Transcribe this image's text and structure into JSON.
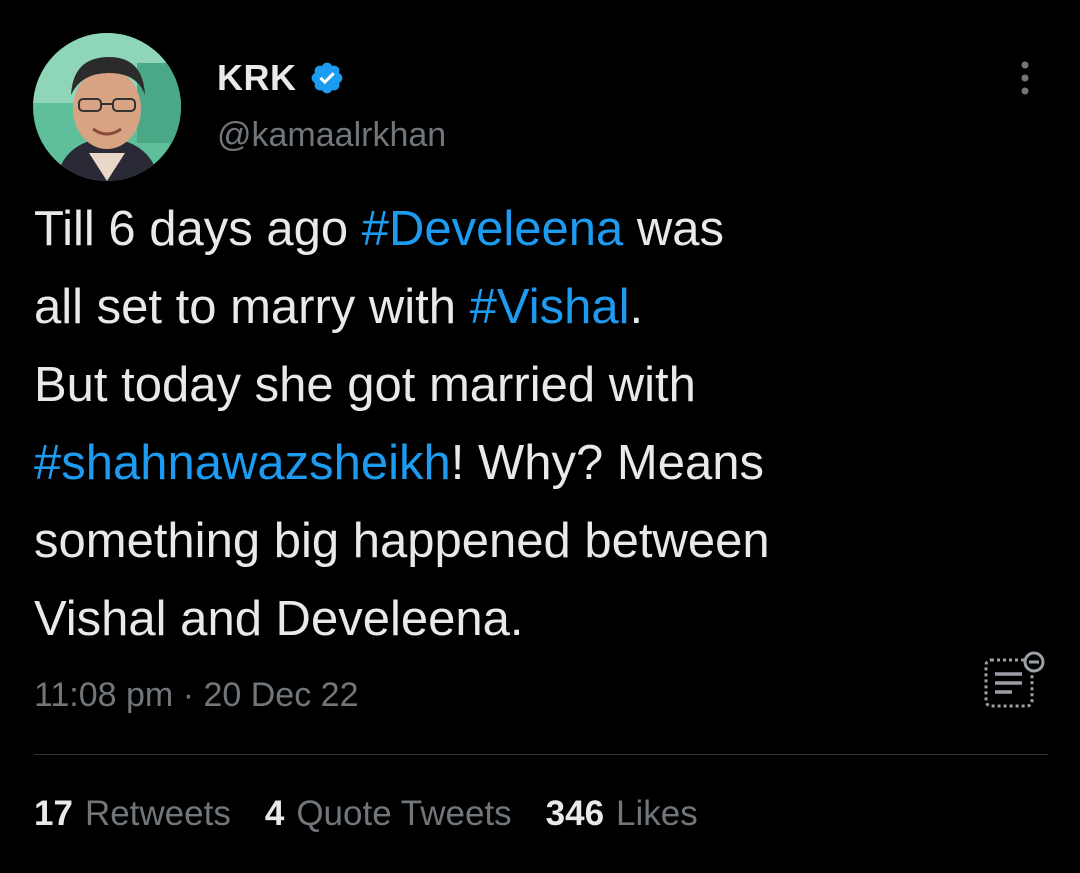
{
  "author": {
    "name": "KRK",
    "handle": "@kamaalrkhan",
    "verified": true,
    "avatar": "avatar-photo"
  },
  "tweet": {
    "segments": [
      {
        "text": "Till 6 days ago ",
        "type": "text"
      },
      {
        "text": "#Develeena",
        "type": "hashtag"
      },
      {
        "text": " was\nall set to marry with ",
        "type": "text"
      },
      {
        "text": "#Vishal",
        "type": "hashtag"
      },
      {
        "text": ".\nBut today she got married with\n",
        "type": "text"
      },
      {
        "text": "#shahnawazsheikh",
        "type": "hashtag"
      },
      {
        "text": "! Why? Means\nsomething big happened between\nVishal and Develeena.",
        "type": "text"
      }
    ],
    "time": "11:08 pm",
    "separator": "·",
    "date": "20 Dec 22"
  },
  "stats": [
    {
      "count": "17",
      "label": "Retweets"
    },
    {
      "count": "4",
      "label": "Quote Tweets"
    },
    {
      "count": "346",
      "label": "Likes"
    }
  ],
  "icons": {
    "verified": "verified-badge-icon",
    "more": "more-options-icon",
    "analytics": "analytics-icon"
  },
  "colors": {
    "background": "#000000",
    "text": "#e7e9ea",
    "secondary": "#71767b",
    "accent": "#1d9bf0",
    "divider": "#2f3336"
  }
}
